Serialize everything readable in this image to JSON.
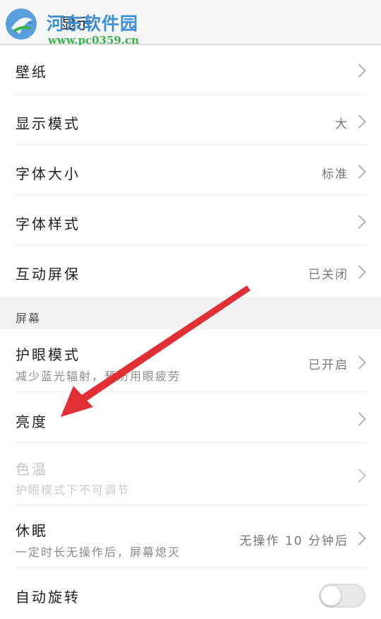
{
  "header": {
    "title": "显示"
  },
  "watermark": {
    "name": "河东软件园",
    "url": "www.pc0359.cn"
  },
  "rows": [
    {
      "title": "壁纸",
      "value": ""
    },
    {
      "title": "显示模式",
      "value": "大"
    },
    {
      "title": "字体大小",
      "value": "标准"
    },
    {
      "title": "字体样式",
      "value": ""
    },
    {
      "title": "互动屏保",
      "value": "已关闭"
    }
  ],
  "section": {
    "label": "屏幕"
  },
  "screen_rows": [
    {
      "title": "护眼模式",
      "subtitle": "减少蓝光辐射，预防用眼疲劳",
      "value": "已开启",
      "enabled": true
    },
    {
      "title": "亮度",
      "subtitle": "",
      "value": "",
      "enabled": true
    },
    {
      "title": "色温",
      "subtitle": "护眼模式下不可调节",
      "value": "",
      "enabled": false
    },
    {
      "title": "休眠",
      "subtitle": "一定时长无操作后，屏幕熄灭",
      "value": "无操作 10 分钟后",
      "enabled": true
    },
    {
      "title": "自动旋转",
      "subtitle": "",
      "value": "",
      "enabled": true,
      "toggle": "off"
    }
  ],
  "colors": {
    "annotation_arrow": "#e03036",
    "watermark_blue": "#3d8fd8",
    "watermark_green": "#39b14a"
  }
}
